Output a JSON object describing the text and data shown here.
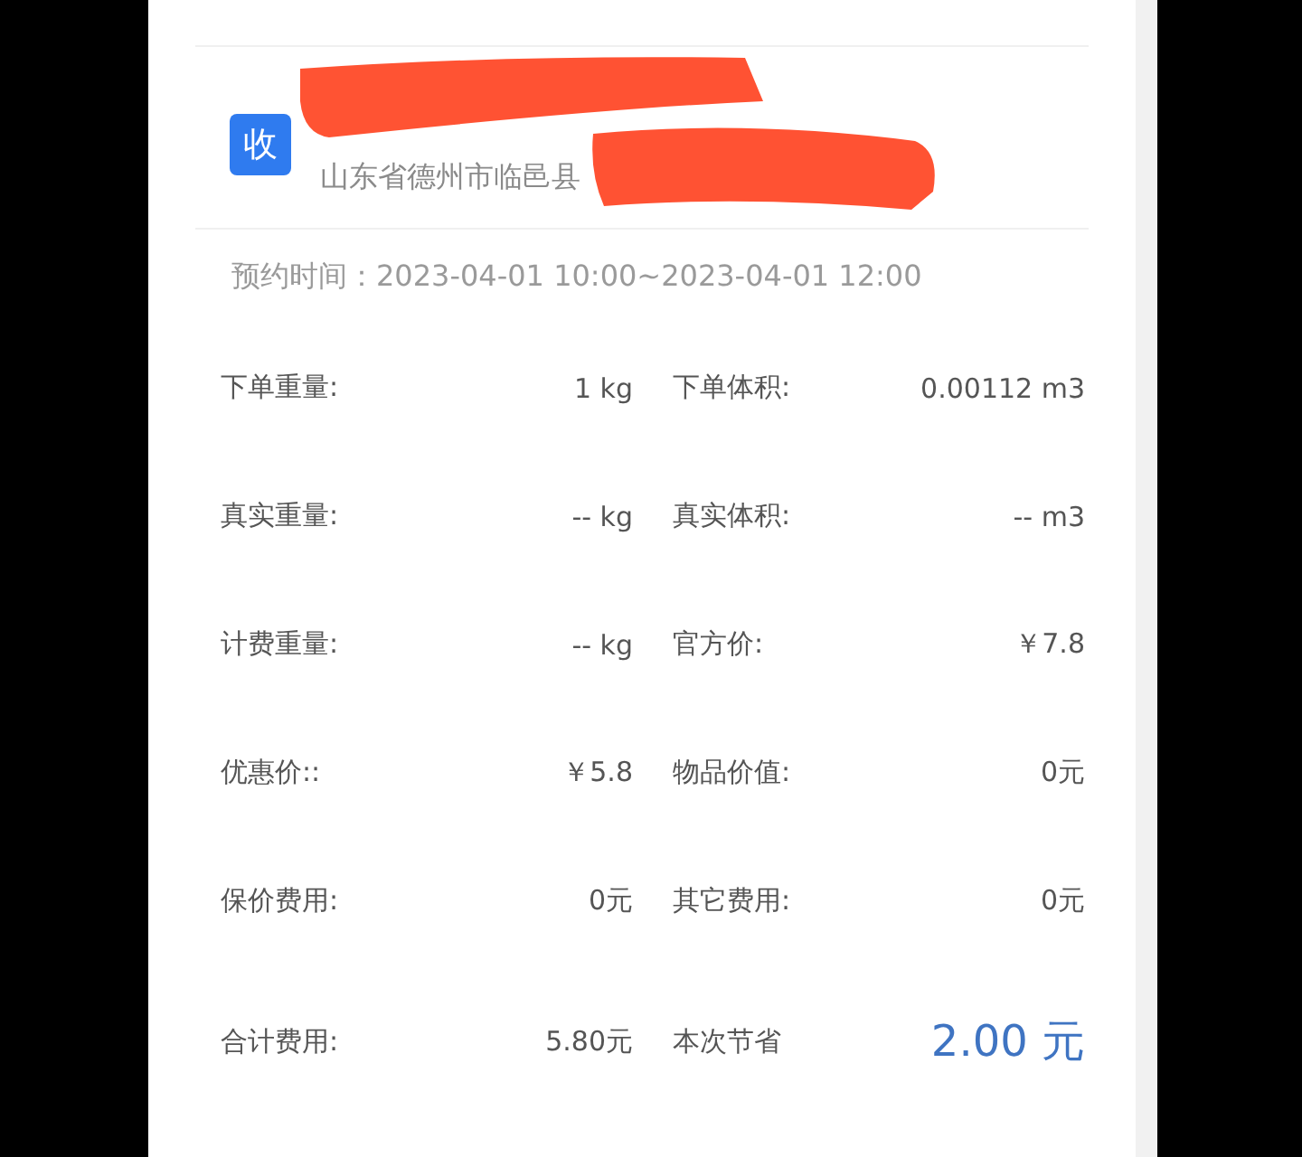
{
  "recipient": {
    "badge": "收",
    "address": "山东省德州市临邑县"
  },
  "appointment": {
    "label": "预约时间：",
    "value": "2023-04-01 10:00~2023-04-01 12:00"
  },
  "rows": [
    {
      "kind": "normal",
      "cells": [
        {
          "label": "下单重量:",
          "value": "1 kg"
        },
        {
          "label": "下单体积:",
          "value": "0.00112 m3"
        }
      ]
    },
    {
      "kind": "normal",
      "cells": [
        {
          "label": "真实重量:",
          "value": "-- kg"
        },
        {
          "label": "真实体积:",
          "value": "-- m3"
        }
      ]
    },
    {
      "kind": "normal",
      "cells": [
        {
          "label": "计费重量:",
          "value": "-- kg"
        },
        {
          "label": "官方价:",
          "value": "￥7.8"
        }
      ]
    },
    {
      "kind": "normal",
      "cells": [
        {
          "label": "优惠价::",
          "value": "￥5.8"
        },
        {
          "label": "物品价值:",
          "value": "0元"
        }
      ]
    },
    {
      "kind": "normal",
      "cells": [
        {
          "label": "保价费用:",
          "value": "0元"
        },
        {
          "label": "其它费用:",
          "value": "0元"
        }
      ]
    },
    {
      "kind": "total",
      "cells": [
        {
          "label": "合计费用:",
          "value": "5.80元",
          "kind": "normal"
        },
        {
          "label": "本次节省",
          "value": "2.00 元",
          "kind": "highlight"
        }
      ]
    }
  ]
}
